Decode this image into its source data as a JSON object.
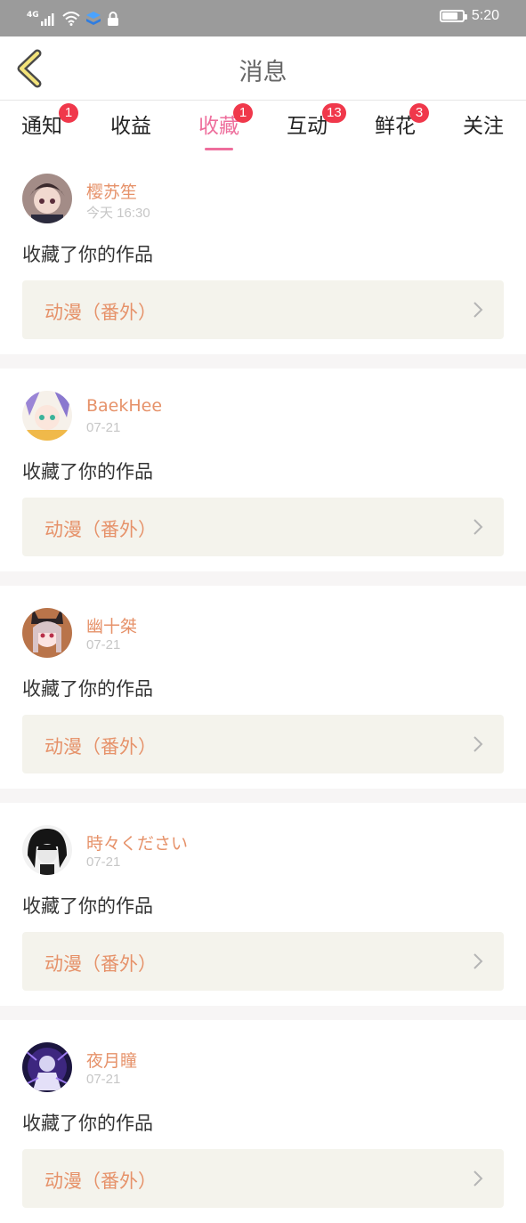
{
  "status_bar": {
    "network": "4G",
    "time": "5:20",
    "icons": [
      "signal-icon",
      "wifi-icon",
      "app-icon",
      "lock-icon",
      "battery-icon"
    ]
  },
  "header": {
    "title": "消息",
    "back_icon": "chevron-left-icon"
  },
  "tabs": [
    {
      "label": "通知",
      "badge": "1",
      "active": false
    },
    {
      "label": "收益",
      "badge": "",
      "active": false
    },
    {
      "label": "收藏",
      "badge": "1",
      "active": true
    },
    {
      "label": "互动",
      "badge": "13",
      "active": false
    },
    {
      "label": "鲜花",
      "badge": "3",
      "active": false
    },
    {
      "label": "关注",
      "badge": "",
      "active": false
    }
  ],
  "colors": {
    "accent_pink": "#ee6e9c",
    "name_orange": "#e6926a",
    "badge_red": "#f0384b",
    "work_bg": "#f4f3ec",
    "status_bar": "#9b9b9b"
  },
  "feed": [
    {
      "name": "樱苏笙",
      "time": "今天 16:30",
      "action": "收藏了你的作品",
      "work": "动漫（番外）"
    },
    {
      "name": "BaekHee",
      "time": "07-21",
      "action": "收藏了你的作品",
      "work": "动漫（番外）"
    },
    {
      "name": "幽十桀",
      "time": "07-21",
      "action": "收藏了你的作品",
      "work": "动漫（番外）"
    },
    {
      "name": "時々ください",
      "time": "07-21",
      "action": "收藏了你的作品",
      "work": "动漫（番外）"
    },
    {
      "name": "夜月瞳",
      "time": "07-21",
      "action": "收藏了你的作品",
      "work": "动漫（番外）"
    }
  ]
}
